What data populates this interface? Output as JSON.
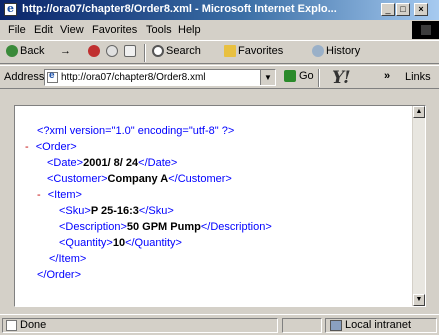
{
  "window": {
    "title": "http://ora07/chapter8/Order8.xml - Microsoft Internet Explo...",
    "minimize_label": "_",
    "maximize_label": "□",
    "close_label": "×"
  },
  "menu": {
    "items": [
      "File",
      "Edit",
      "View",
      "Favorites",
      "Tools",
      "Help"
    ]
  },
  "toolbar": {
    "back_label": "Back",
    "forward_label": "→",
    "stop_label": "",
    "refresh_label": "",
    "home_label": "",
    "search_label": "Search",
    "favorites_label": "Favorites",
    "history_label": "History"
  },
  "addressbar": {
    "label": "Address",
    "url": "http://ora07/chapter8/Order8.xml",
    "go_label": "Go",
    "yahoo_label": "Y!",
    "chevron_label": "»",
    "links_label": "Links"
  },
  "document": {
    "declaration": "<?xml version=\"1.0\" encoding=\"utf-8\" ?>",
    "lines": [
      {
        "prefix": "- ",
        "open": "<Order>",
        "text": "",
        "close": ""
      },
      {
        "prefix": "",
        "open": "<Date>",
        "text": "2001/ 8/ 24",
        "close": "</Date>"
      },
      {
        "prefix": "",
        "open": "<Customer>",
        "text": "Company A",
        "close": "</Customer>"
      },
      {
        "prefix": "- ",
        "open": "<Item>",
        "text": "",
        "close": ""
      },
      {
        "prefix": "",
        "open": "<Sku>",
        "text": "P 25-16:3",
        "close": "</Sku>"
      },
      {
        "prefix": "",
        "open": "<Description>",
        "text": "50 GPM Pump",
        "close": "</Description>"
      },
      {
        "prefix": "",
        "open": "<Quantity>",
        "text": "10",
        "close": "</Quantity>"
      },
      {
        "prefix": "",
        "open": "</Item>",
        "text": "",
        "close": ""
      },
      {
        "prefix": "",
        "open": "</Order>",
        "text": "",
        "close": ""
      }
    ]
  },
  "status": {
    "left_text": "Done",
    "zone_text": "Local intranet"
  }
}
